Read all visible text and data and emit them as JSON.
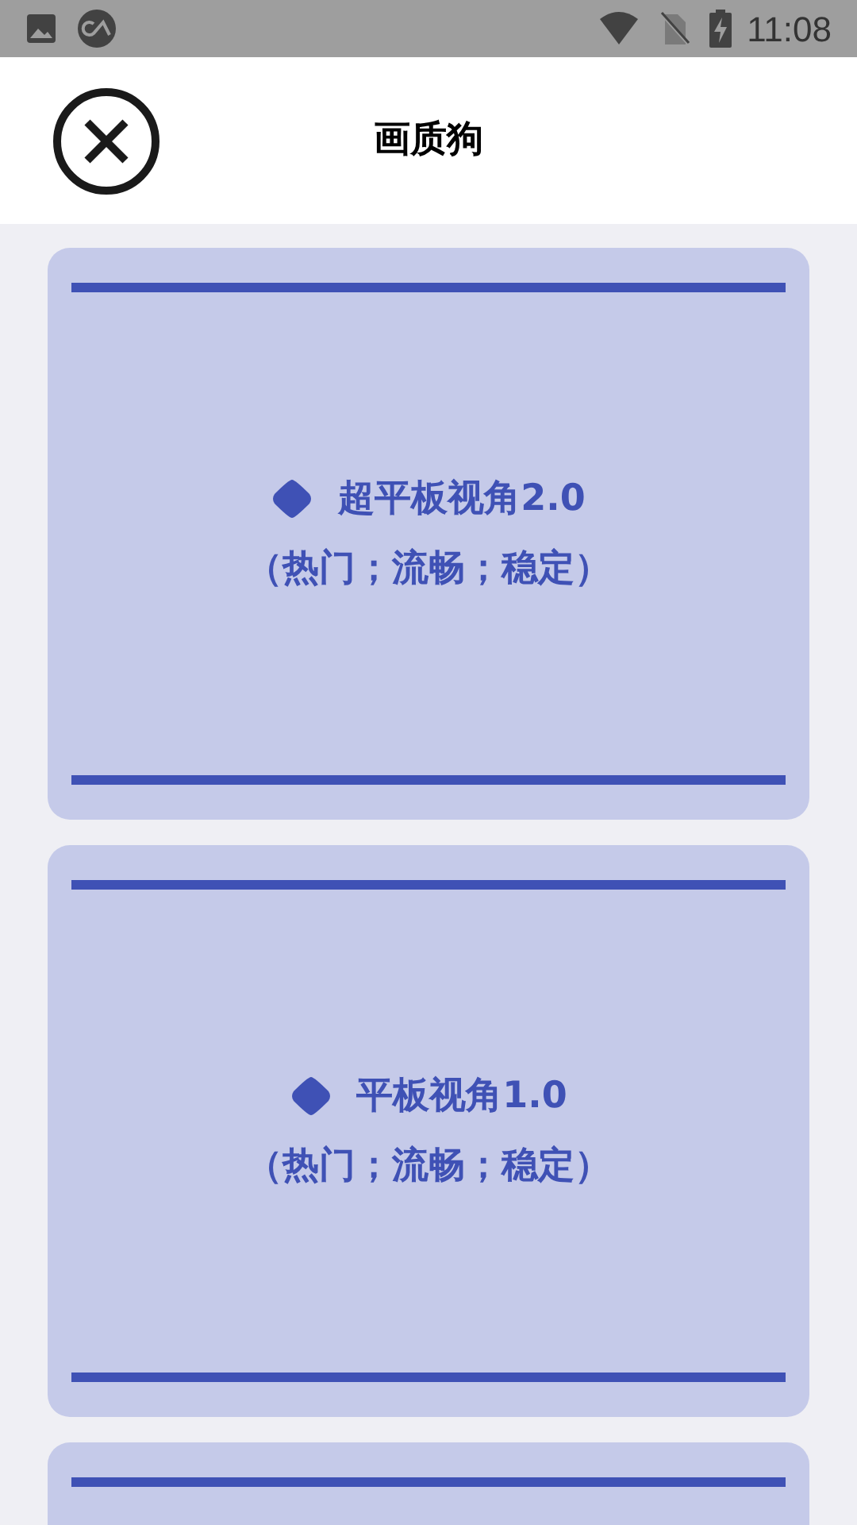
{
  "status_bar": {
    "time": "11:08"
  },
  "header": {
    "title": "画质狗"
  },
  "cards": [
    {
      "title": "超平板视角2.0",
      "subtitle": "（热门；流畅；稳定）"
    },
    {
      "title": "平板视角1.0",
      "subtitle": "（热门；流畅；稳定）"
    }
  ]
}
